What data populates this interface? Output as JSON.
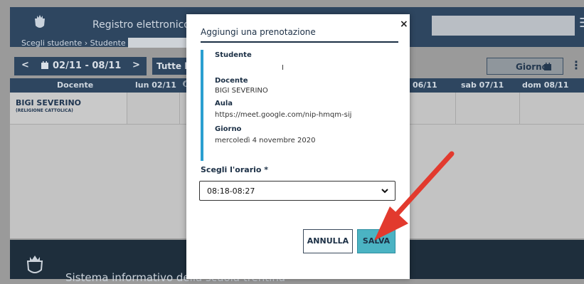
{
  "app": {
    "title": "Registro elettronico FAMIG",
    "breadcrumb": "Scegli studente  ›  Studente",
    "footer_text": "Sistema informativo della scuola trentina"
  },
  "toolbar": {
    "prev_label": "<",
    "date_range": "02/11 - 08/11",
    "next_label": ">",
    "all_label": "Tutte le",
    "view_label": "Giorno",
    "menu_label": "⋮"
  },
  "grid": {
    "columns": [
      "Docente",
      "lun 02/11",
      "06/11",
      "sab 07/11",
      "dom 08/11"
    ],
    "rows": [
      {
        "teacher": "BIGI SEVERINO",
        "subject": "(RELIGIONE CATTOLICA)"
      }
    ]
  },
  "modal": {
    "title": "Aggiungi una prenotazione",
    "student_label": "Studente",
    "student_value": "I",
    "teacher_label": "Docente",
    "teacher_value": "BIGI SEVERINO",
    "room_label": "Aula",
    "room_value": "https://meet.google.com/nip-hmqm-sij",
    "day_label": "Giorno",
    "day_value": "mercoledì 4 novembre 2020",
    "time_label": "Scegli l'orario *",
    "time_value": "08:18-08:27",
    "cancel_label": "ANNULLA",
    "save_label": "SALVA",
    "close_label": "×"
  },
  "colors": {
    "header": "#2e4660",
    "accent": "#2a9fd0",
    "save": "#4bb3c3",
    "arrow": "#e23a2e"
  }
}
